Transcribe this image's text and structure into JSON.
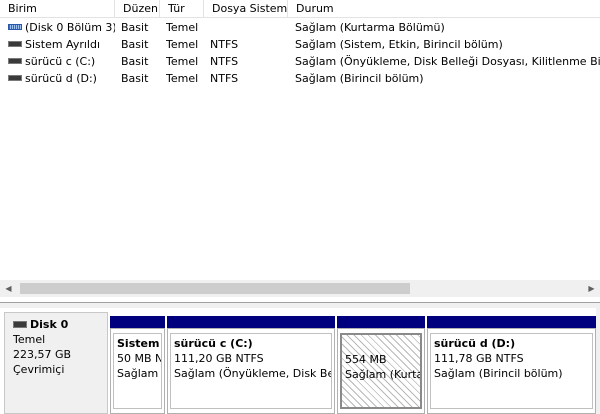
{
  "volume_list": {
    "columns": [
      "Birim",
      "Düzen",
      "Tür",
      "Dosya Sistemi",
      "Durum"
    ],
    "rows": [
      {
        "icon": "striped-volume-icon",
        "name": "(Disk 0 Bölüm 3)",
        "layout": "Basit",
        "type": "Temel",
        "fs": "",
        "status": "Sağlam (Kurtarma Bölümü)"
      },
      {
        "icon": "drive-volume-icon",
        "name": "Sistem Ayrıldı",
        "layout": "Basit",
        "type": "Temel",
        "fs": "NTFS",
        "status": "Sağlam (Sistem, Etkin, Birincil bölüm)"
      },
      {
        "icon": "drive-volume-icon",
        "name": "sürücü c (C:)",
        "layout": "Basit",
        "type": "Temel",
        "fs": "NTFS",
        "status": "Sağlam (Önyükleme, Disk Belleği Dosyası, Kilitlenme Bilgisi"
      },
      {
        "icon": "drive-volume-icon",
        "name": "sürücü d (D:)",
        "layout": "Basit",
        "type": "Temel",
        "fs": "NTFS",
        "status": "Sağlam (Birincil bölüm)"
      }
    ]
  },
  "scrollbar": {
    "left_arrow": "◀",
    "right_arrow": "▶"
  },
  "disk": {
    "title": "Disk 0",
    "type": "Temel",
    "size": "223,57 GB",
    "state": "Çevrimiçi"
  },
  "partitions": [
    {
      "name": "Sistem",
      "size": "50 MB N",
      "status": "Sağlam"
    },
    {
      "name": "sürücü c  (C:)",
      "size": "111,20 GB NTFS",
      "status": "Sağlam (Önyükleme, Disk Bel"
    },
    {
      "name": "",
      "size": "554 MB",
      "status": "Sağlam (Kurta"
    },
    {
      "name": "sürücü d  (D:)",
      "size": "111,78 GB NTFS",
      "status": "Sağlam (Birincil bölüm)"
    }
  ],
  "colors": {
    "partition_bar": "#00007f",
    "panel_bg": "#f0f0f0"
  }
}
